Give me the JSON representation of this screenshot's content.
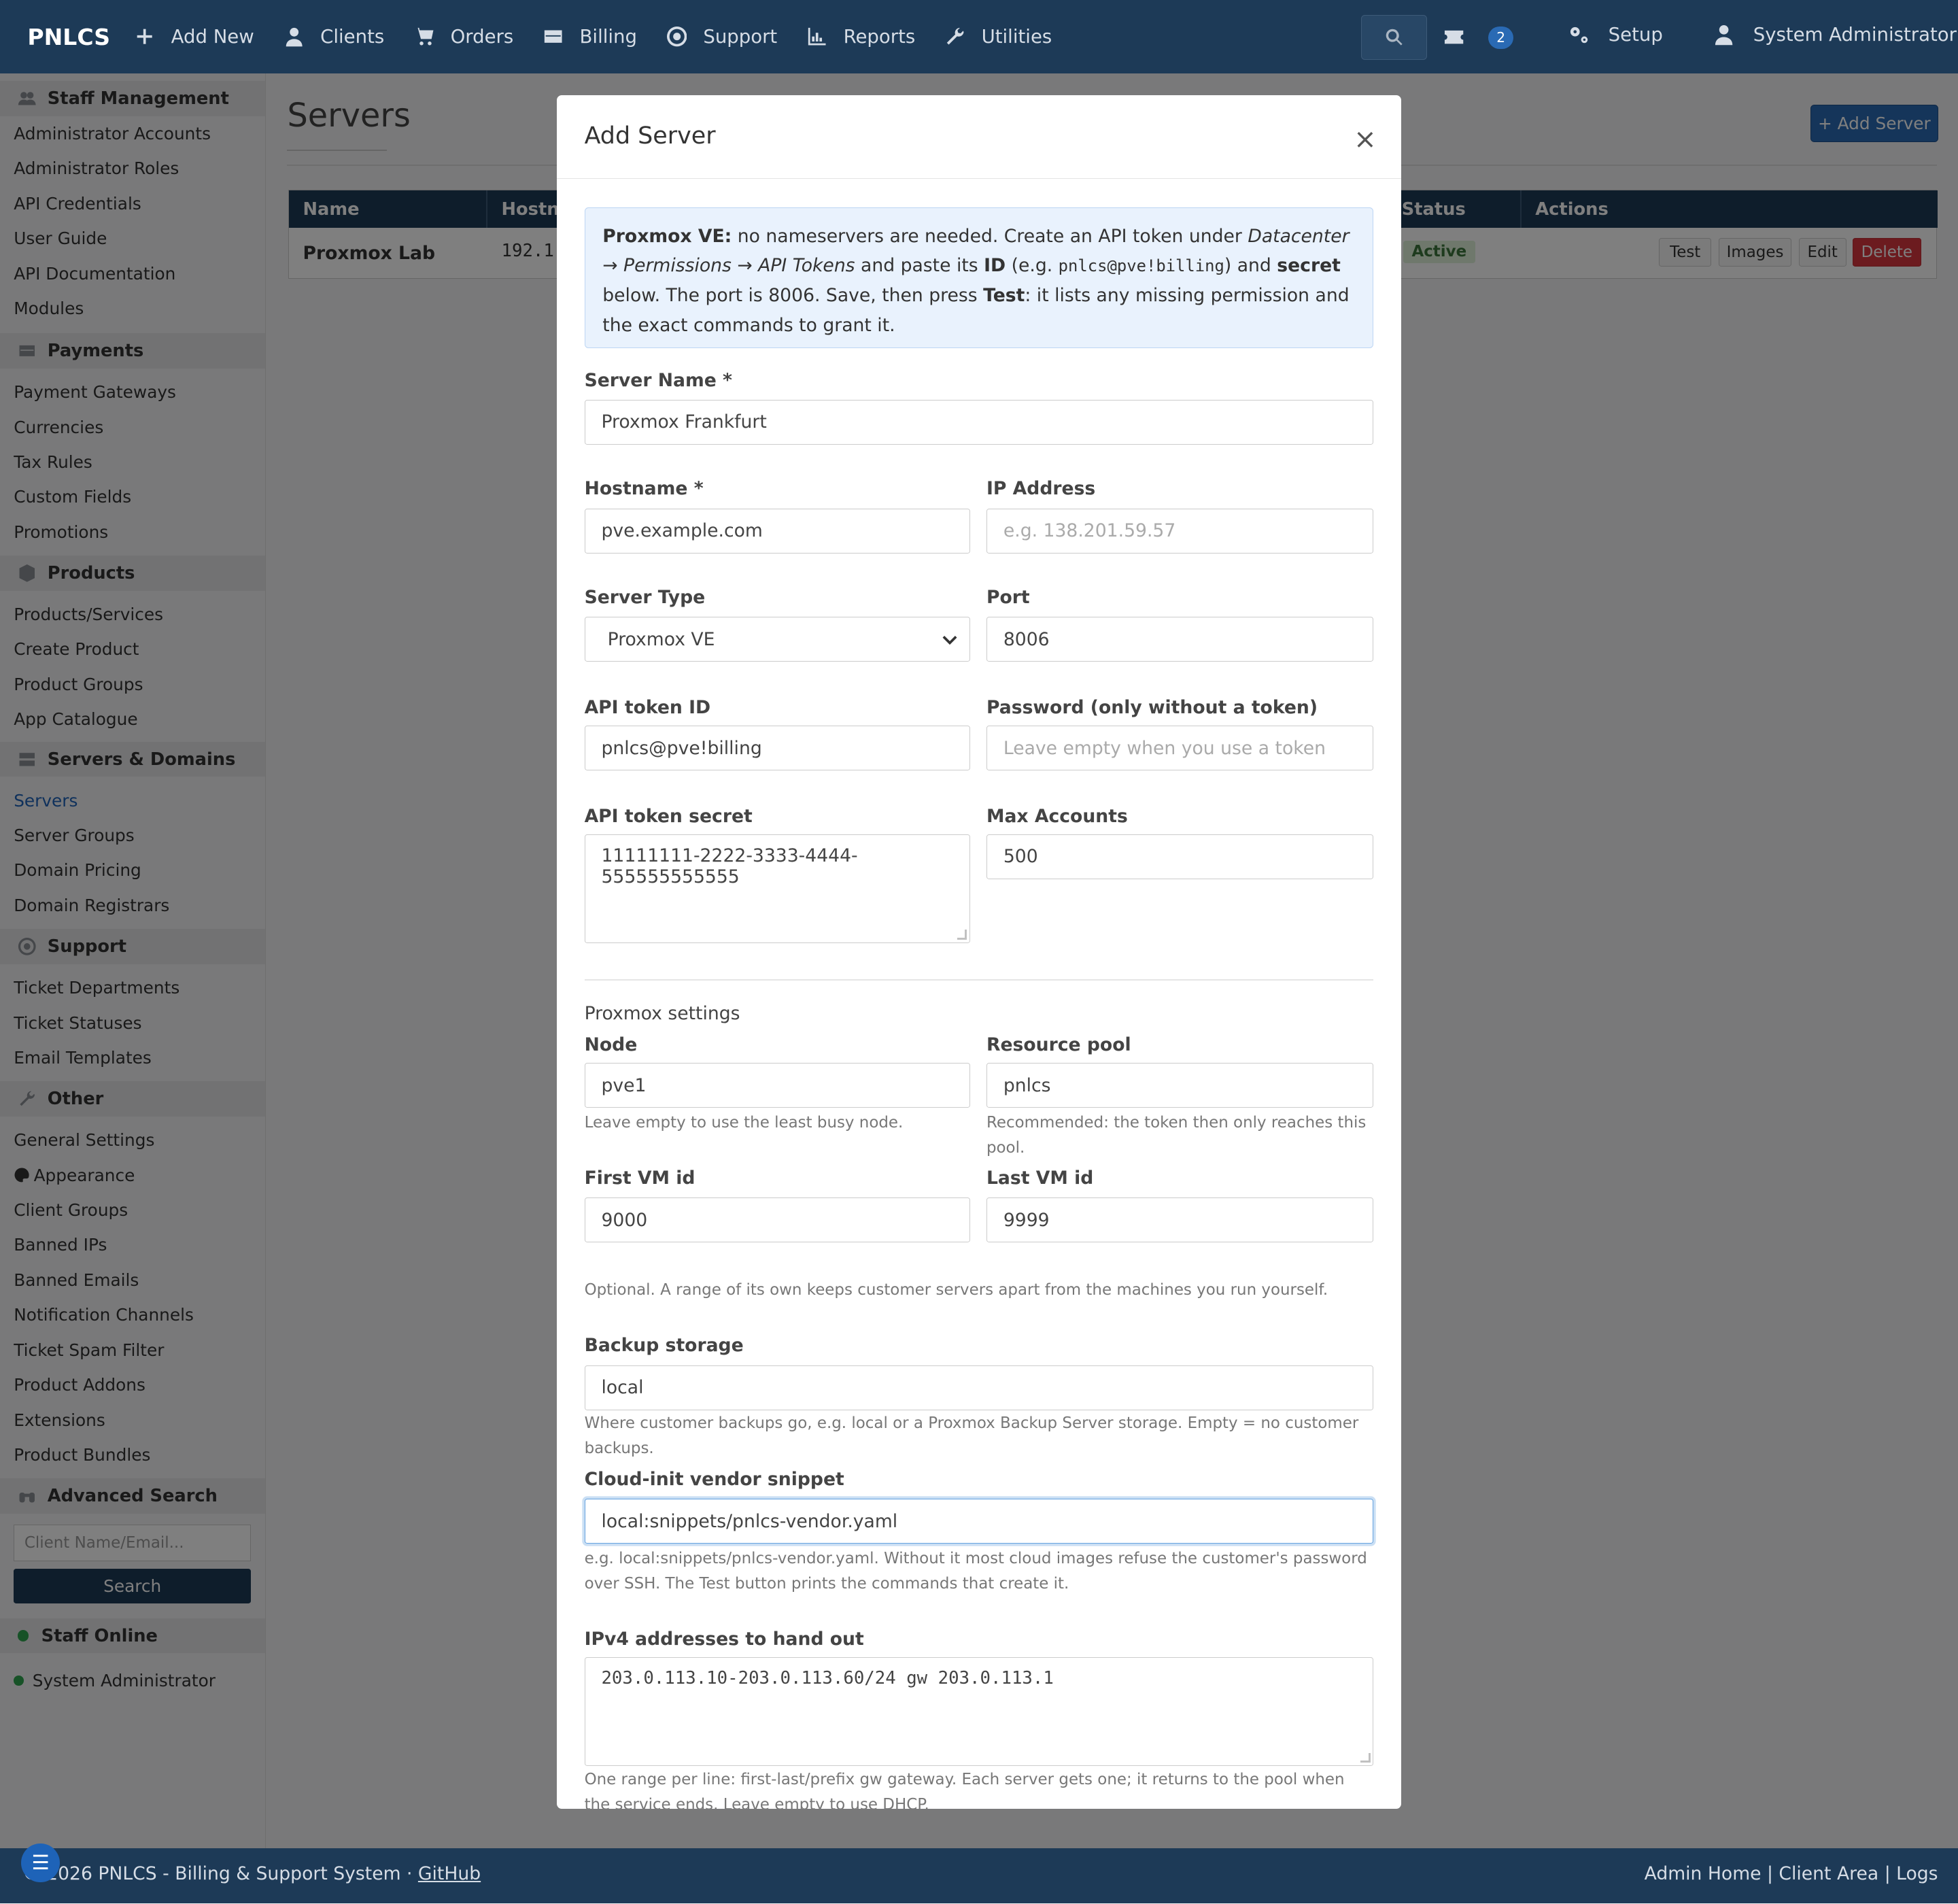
{
  "nav": {
    "brand": "PNLCS",
    "items": [
      {
        "icon": "plus-icon",
        "label": "Add New"
      },
      {
        "icon": "user-icon",
        "label": "Clients"
      },
      {
        "icon": "cart-icon",
        "label": "Orders"
      },
      {
        "icon": "credit-card-icon",
        "label": "Billing"
      },
      {
        "icon": "lifebuoy-icon",
        "label": "Support"
      },
      {
        "icon": "chart-icon",
        "label": "Reports"
      },
      {
        "icon": "wrench-icon",
        "label": "Utilities"
      }
    ],
    "ticket_badge": "2",
    "setup_label": "Setup",
    "user_label": "System Administrator"
  },
  "sidebar": {
    "staff_management": {
      "title": "Staff Management",
      "items": [
        "Administrator Accounts",
        "Administrator Roles",
        "API Credentials",
        "User Guide",
        "API Documentation",
        "Modules"
      ]
    },
    "payments": {
      "title": "Payments",
      "items": [
        "Payment Gateways",
        "Currencies",
        "Tax Rules",
        "Custom Fields",
        "Promotions"
      ]
    },
    "products": {
      "title": "Products",
      "items": [
        "Products/Services",
        "Create Product",
        "Product Groups",
        "App Catalogue"
      ]
    },
    "servers_domains": {
      "title": "Servers & Domains",
      "items": [
        "Servers",
        "Server Groups",
        "Domain Pricing",
        "Domain Registrars"
      ]
    },
    "support": {
      "title": "Support",
      "items": [
        "Ticket Departments",
        "Ticket Statuses",
        "Email Templates"
      ]
    },
    "other": {
      "title": "Other",
      "items": [
        "General Settings",
        "Appearance",
        "Client Groups",
        "Banned IPs",
        "Banned Emails",
        "Notification Channels",
        "Ticket Spam Filter",
        "Product Addons",
        "Extensions",
        "Product Bundles"
      ]
    },
    "advanced_search": {
      "title": "Advanced Search",
      "placeholder": "Client Name/Email...",
      "button": "Search"
    },
    "staff_online": {
      "title": "Staff Online",
      "user": "System Administrator"
    }
  },
  "page": {
    "title": "Servers",
    "add_button": "+ Add Server",
    "table": {
      "headers": [
        "Name",
        "Hostna",
        "Status",
        "Actions"
      ],
      "rows": [
        {
          "name": "Proxmox Lab",
          "host": "192.1",
          "status": "Active"
        }
      ],
      "actions": [
        "Test",
        "Images",
        "Edit",
        "Delete"
      ]
    }
  },
  "modal": {
    "title": "Add Server",
    "close": "×",
    "info": {
      "p1": "Proxmox VE:",
      "p2": " no nameservers are needed. Create an API token under ",
      "p3": "Datacenter → Permissions → API Tokens",
      "p4": " and paste its ",
      "p5": "ID",
      "p6": " (e.g. ",
      "p7": "pnlcs@pve!billing",
      "p8": ") and ",
      "p9": "secret",
      "p10": " below. The port is 8006. Save, then press ",
      "p11": "Test",
      "p12": ": it lists any missing permission and the exact commands to grant it."
    },
    "server_name": {
      "label": "Server Name *",
      "value": "Proxmox Frankfurt"
    },
    "hostname": {
      "label": "Hostname *",
      "value": "pve.example.com"
    },
    "ip_address": {
      "label": "IP Address",
      "placeholder": "e.g. 138.201.59.57"
    },
    "server_type": {
      "label": "Server Type",
      "value": "Proxmox VE"
    },
    "port": {
      "label": "Port",
      "value": "8006"
    },
    "api_token_id": {
      "label": "API token ID",
      "value": "pnlcs@pve!billing"
    },
    "password": {
      "label": "Password (only without a token)",
      "placeholder": "Leave empty when you use a token"
    },
    "api_token_secret": {
      "label": "API token secret",
      "value": "11111111-2222-3333-4444-555555555555"
    },
    "max_accounts": {
      "label": "Max Accounts",
      "value": "500"
    },
    "proxmox_section": "Proxmox settings",
    "node": {
      "label": "Node",
      "value": "pve1",
      "help": "Leave empty to use the least busy node."
    },
    "resource_pool": {
      "label": "Resource pool",
      "value": "pnlcs",
      "help": "Recommended: the token then only reaches this pool."
    },
    "first_vm": {
      "label": "First VM id",
      "value": "9000"
    },
    "last_vm": {
      "label": "Last VM id",
      "value": "9999"
    },
    "vm_range_help": "Optional. A range of its own keeps customer servers apart from the machines you run yourself.",
    "backup_storage": {
      "label": "Backup storage",
      "value": "local",
      "help": "Where customer backups go, e.g. local or a Proxmox Backup Server storage. Empty = no customer backups."
    },
    "cloud_init": {
      "label": "Cloud-init vendor snippet",
      "value": "local:snippets/pnlcs-vendor.yaml",
      "help": "e.g. local:snippets/pnlcs-vendor.yaml. Without it most cloud images refuse the customer's password over SSH. The Test button prints the commands that create it."
    },
    "ipv4": {
      "label": "IPv4 addresses to hand out",
      "value": "203.0.113.10-203.0.113.60/24 gw 203.0.113.1",
      "help": "One range per line: first-last/prefix gw gateway. Each server gets one; it returns to the pool when the service ends. Leave empty to use DHCP."
    }
  },
  "footer": {
    "left": "© 2026 PNLCS - Billing & Support System · ",
    "github": "GitHub",
    "right": "Admin Home | Client Area | Logs"
  },
  "colors": {
    "navy": "#1d3a57",
    "accent": "#2a6ab4",
    "danger": "#d9363e",
    "success_bg": "#dff0d8",
    "info_bg": "#e9f2fd"
  }
}
